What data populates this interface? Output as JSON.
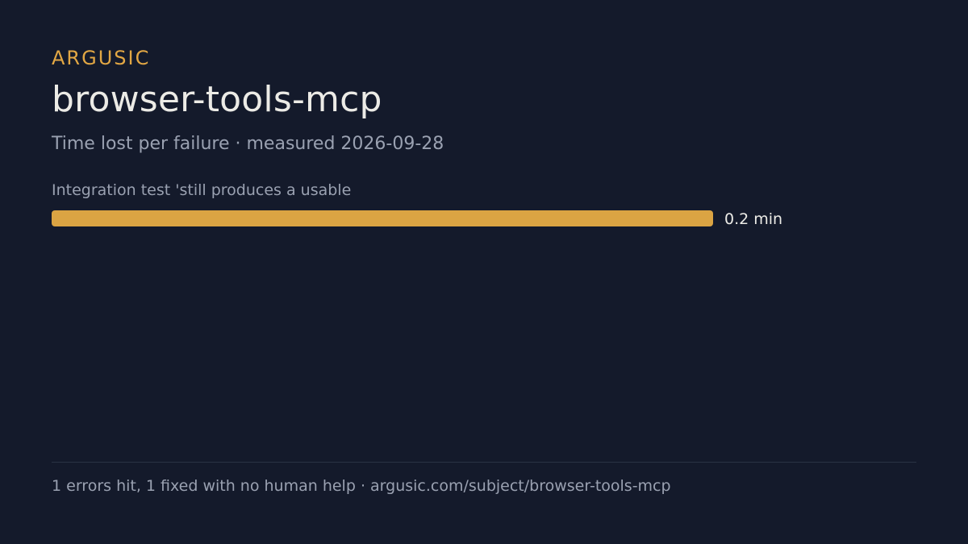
{
  "brand": "ARGUSIC",
  "title": "browser-tools-mcp",
  "subtitle": "Time lost per failure · measured 2026-09-28",
  "footer": "1 errors hit, 1 fixed with no human help · argusic.com/subject/browser-tools-mcp",
  "colors": {
    "background": "#141a2b",
    "accent": "#e2a744",
    "bar": "#dba443",
    "title": "#ecebe6",
    "muted": "#9aa1b1",
    "value": "#ecebe6"
  },
  "chart_data": {
    "type": "bar",
    "orientation": "horizontal",
    "categories": [
      "Integration test 'still produces a usable"
    ],
    "values": [
      0.2
    ],
    "value_labels": [
      "0.2 min"
    ],
    "unit": "min",
    "xlim": [
      0,
      0.2
    ],
    "grid": false,
    "legend": "none"
  }
}
